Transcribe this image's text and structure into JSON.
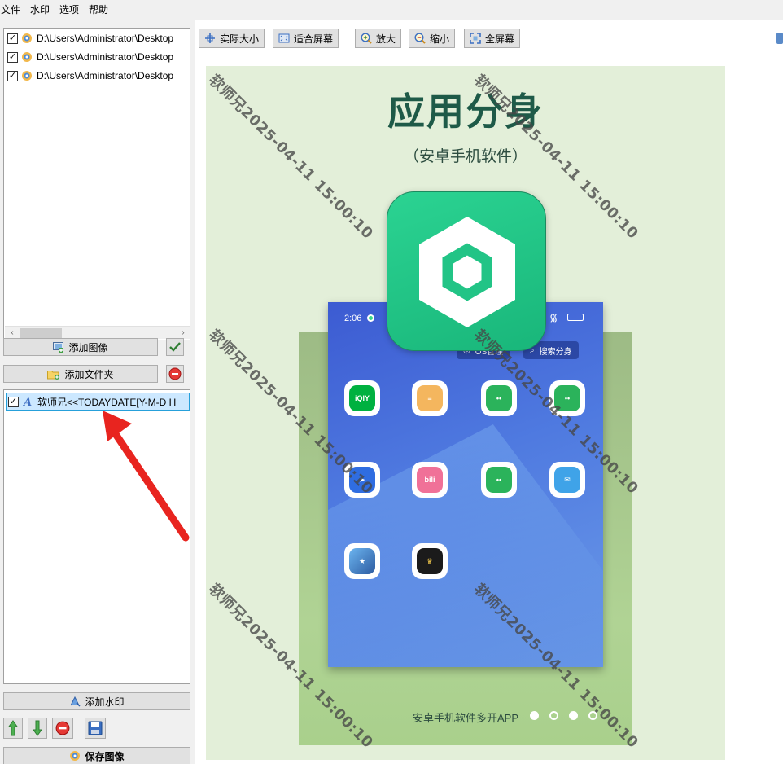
{
  "menu": [
    "文件",
    "水印",
    "选项",
    "帮助"
  ],
  "file_list": {
    "items": [
      {
        "label": "D:\\Users\\Administrator\\Desktop",
        "checked": true
      },
      {
        "label": "D:\\Users\\Administrator\\Desktop",
        "checked": true
      },
      {
        "label": "D:\\Users\\Administrator\\Desktop",
        "checked": true
      }
    ]
  },
  "buttons": {
    "add_image": "添加图像",
    "add_folder": "添加文件夹",
    "add_watermark": "添加水印",
    "save_image": "保存图像"
  },
  "watermark_list": {
    "items": [
      {
        "label": "软师兄<<TODAYDATE[Y-M-D H",
        "checked": true
      }
    ]
  },
  "toolbar": {
    "actual_size": "实际大小",
    "fit_screen": "适合屏幕",
    "zoom_in": "放大",
    "zoom_out": "缩小",
    "fullscreen": "全屏幕"
  },
  "preview": {
    "title": "应用分身",
    "subtitle": "（安卓手机软件）",
    "status_time": "2:06",
    "pill_left": "OS管理",
    "pill_right": "搜索分身",
    "footer_text": "安卓手机软件多开APP",
    "watermark_text": "软师兄2025-04-11 15:00:10",
    "pager_dots": [
      true,
      false,
      true,
      false
    ]
  },
  "colors": {
    "canvas_bg": "#e3efd9",
    "title": "#1e5a48",
    "accent_green": "#22c486",
    "phone_blue": "#4a6fdc",
    "arrow_red": "#e8241f"
  }
}
